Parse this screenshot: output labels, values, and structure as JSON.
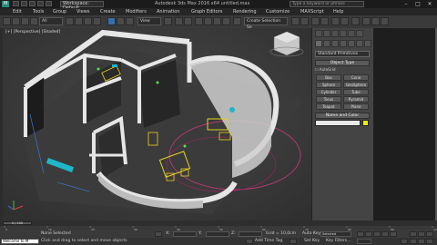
{
  "titlebar": {
    "workspace": "Workspace: Default",
    "title": "Autodesk 3ds Max 2016 x64   untitled.max",
    "search_placeholder": "Type a keyword or phrase"
  },
  "menus": [
    "Edit",
    "Tools",
    "Group",
    "Views",
    "Create",
    "Modifiers",
    "Animation",
    "Graph Editors",
    "Rendering",
    "Customize",
    "MAXScript",
    "Help"
  ],
  "toolbar": {
    "filter": "All",
    "refcoord": "View",
    "selset": "Create Selection Se"
  },
  "viewport": {
    "label": "[+] [Perspective] [Shaded]"
  },
  "cmdpanel": {
    "category": "Standard Primitives",
    "object_type_header": "Object Type",
    "autogrid": "AutoGrid",
    "objects": [
      "Box",
      "Cone",
      "Sphere",
      "GeoSphere",
      "Cylinder",
      "Tube",
      "Torus",
      "Pyramid",
      "Teapot",
      "Plane"
    ],
    "name_color_header": "Name and Color"
  },
  "timeline": {
    "slider": "0 / 100",
    "ticks": [
      "0",
      "10",
      "20",
      "30",
      "40",
      "50",
      "60",
      "70",
      "80",
      "90",
      "100"
    ]
  },
  "status": {
    "maxscript": "Welcome to M",
    "selection": "None Selected",
    "prompt": "Click and drag to select and move objects",
    "x_label": "X:",
    "y_label": "Y:",
    "z_label": "Z:",
    "grid": "Grid = 10,0cm",
    "autokey": "Auto Key",
    "autokey_value": "Selected",
    "setkey": "Set Key",
    "keyfilters": "Key Filters...",
    "addtimetag": "Add Time Tag"
  },
  "colors": {
    "accent": "#3570a8",
    "object_color": "#f2f200",
    "walls": "#e6e6e6"
  }
}
